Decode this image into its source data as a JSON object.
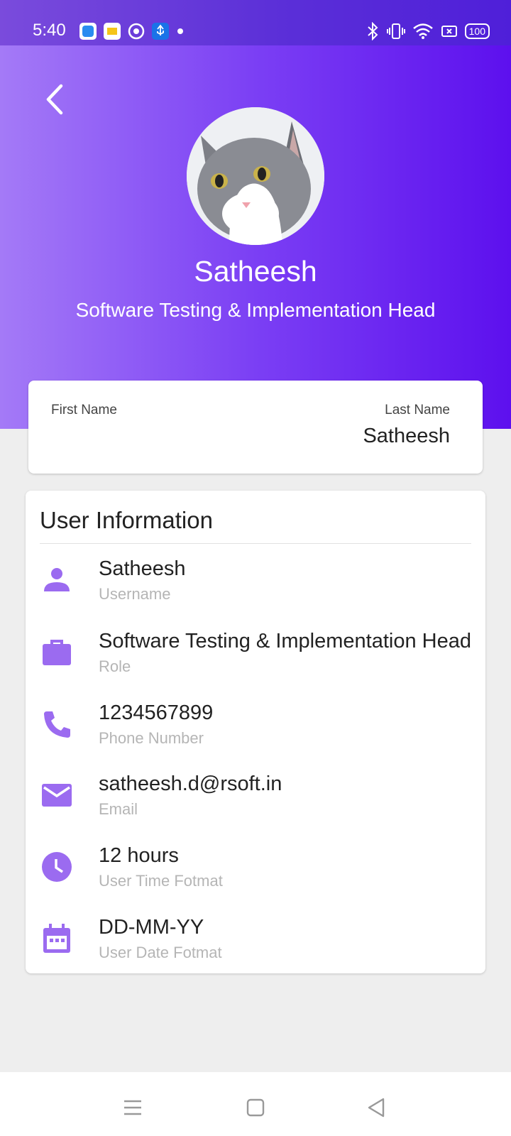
{
  "status_bar": {
    "time": "5:40",
    "battery": "100",
    "left_icons": [
      "app-blue-icon",
      "app-yellow-icon",
      "chrome-icon",
      "usb-icon",
      "dot-icon"
    ],
    "right_icons": [
      "bluetooth-icon",
      "vibrate-icon",
      "wifi-icon",
      "screen-icon",
      "battery-icon"
    ]
  },
  "colors": {
    "accent": "#9B6BF0",
    "header_start": "#A47AF7",
    "header_end": "#5D10EE",
    "status_bar": "#6A3DDC"
  },
  "profile": {
    "name": "Satheesh",
    "role": "Software Testing & Implementation Head"
  },
  "name_card": {
    "first_name_label": "First Name",
    "first_name_value": "",
    "last_name_label": "Last Name",
    "last_name_value": "Satheesh"
  },
  "user_info": {
    "title": "User Information",
    "items": [
      {
        "icon": "person-icon",
        "value": "Satheesh",
        "label": "Username"
      },
      {
        "icon": "briefcase-icon",
        "value": "Software Testing & Implementation Head",
        "label": "Role"
      },
      {
        "icon": "phone-icon",
        "value": "1234567899",
        "label": "Phone Number"
      },
      {
        "icon": "email-icon",
        "value": "satheesh.d@rsoft.in",
        "label": "Email"
      },
      {
        "icon": "clock-icon",
        "value": "12 hours",
        "label": "User Time Fotmat"
      },
      {
        "icon": "calendar-icon",
        "value": "DD-MM-YY",
        "label": "User Date Fotmat"
      }
    ]
  },
  "nav_bar": {
    "buttons": [
      "menu-button",
      "home-button",
      "back-button"
    ]
  }
}
